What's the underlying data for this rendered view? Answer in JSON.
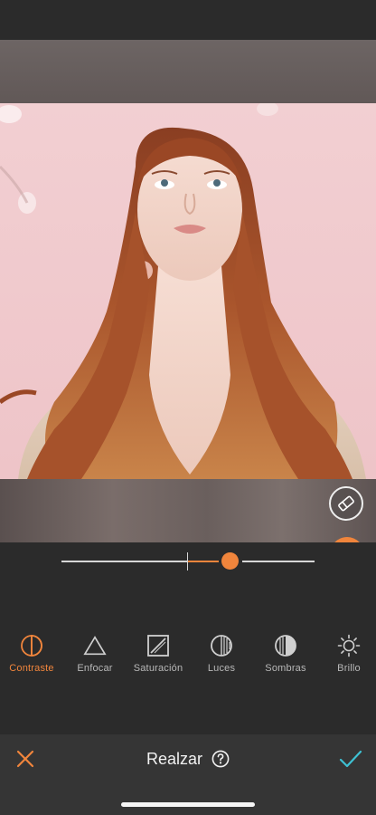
{
  "editor": {
    "title": "Realzar",
    "cancel_icon": "close-icon",
    "confirm_icon": "checkmark-icon",
    "help_icon": "help-circle-icon"
  },
  "slider": {
    "value_fraction": 0.67,
    "min": -1,
    "max": 1,
    "center": 0
  },
  "tools": [
    {
      "label": "Contraste",
      "icon": "contrast-icon",
      "active": true
    },
    {
      "label": "Enfocar",
      "icon": "triangle-icon",
      "active": false
    },
    {
      "label": "Saturación",
      "icon": "saturation-icon",
      "active": false
    },
    {
      "label": "Luces",
      "icon": "highlights-icon",
      "active": false
    },
    {
      "label": "Sombras",
      "icon": "shadows-icon",
      "active": false
    },
    {
      "label": "Brillo",
      "icon": "sun-icon",
      "active": false
    }
  ],
  "canvas": {
    "photo_subject": "red-haired woman looking up against pink wall",
    "eraser_icon": "eraser-icon",
    "compare_icon": "compare-icon"
  },
  "colors": {
    "accent": "#f0853c",
    "confirm": "#3ec1d3",
    "background": "#2b2b2b",
    "photo_background": "#f0c8cc"
  }
}
